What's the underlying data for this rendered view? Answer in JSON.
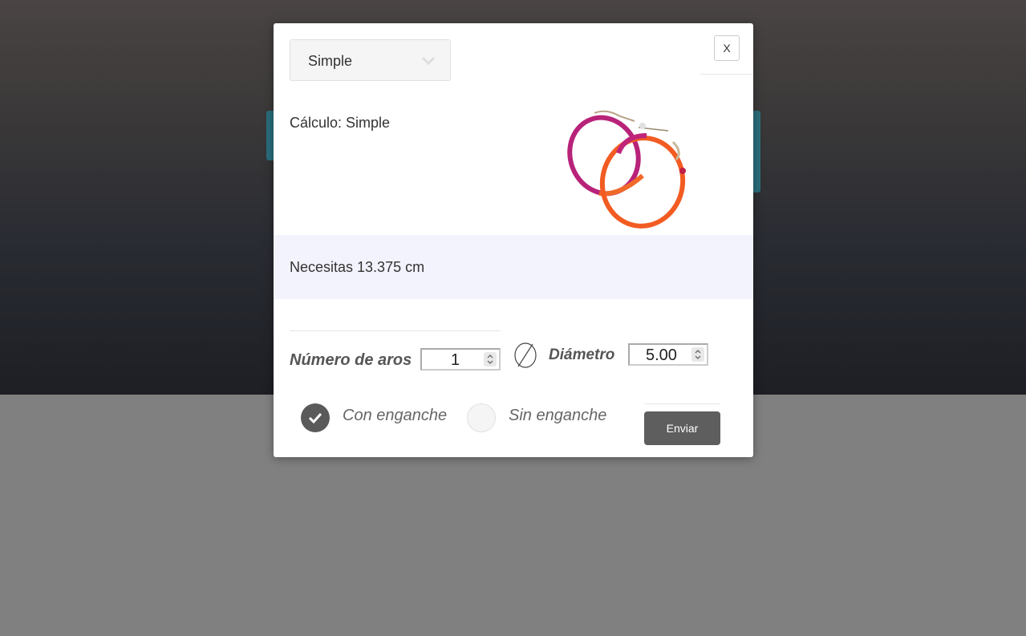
{
  "select": {
    "value": "Simple"
  },
  "close": {
    "label": "X"
  },
  "calc": {
    "label": "Cálculo: Simple"
  },
  "result": {
    "text": "Necesitas 13.375 cm"
  },
  "hoops": {
    "label": "Número de aros",
    "value": "1"
  },
  "diameter": {
    "label": "Diámetro",
    "value": "5.00"
  },
  "options": [
    {
      "label": "Con enganche",
      "checked": true
    },
    {
      "label": "Sin enganche",
      "checked": false
    }
  ],
  "submit": {
    "label": "Enviar"
  },
  "colors": {
    "accent_button": "#5e5e5e",
    "result_band": "#f3f3fd",
    "radio_checked": "#5a5a5a"
  },
  "icons": [
    "chevron-down-icon",
    "diameter-icon",
    "check-icon",
    "earring-image"
  ]
}
